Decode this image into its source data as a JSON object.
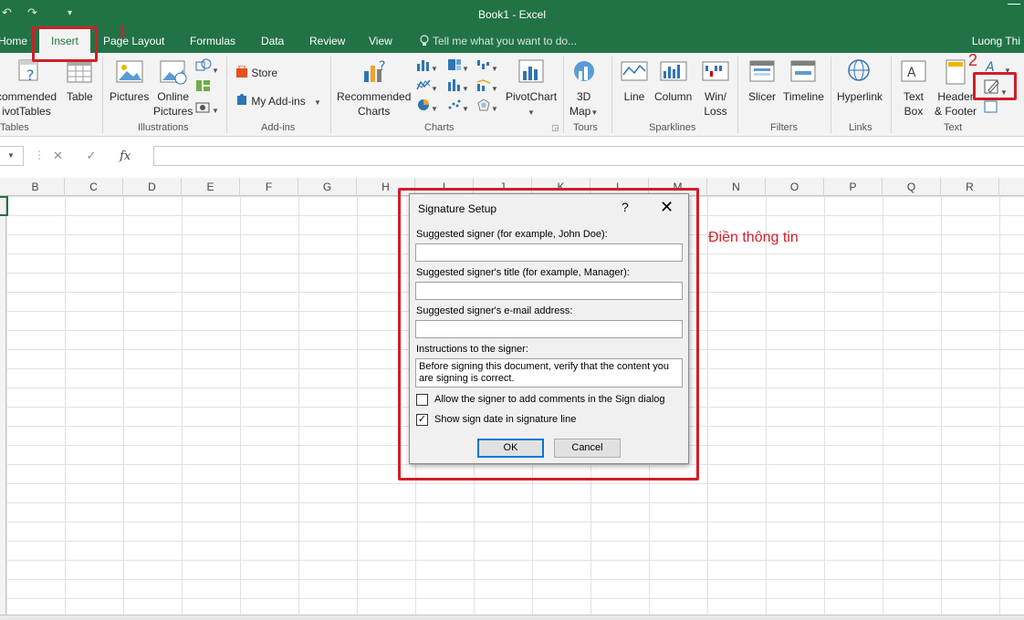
{
  "window": {
    "title": "Book1 - Excel",
    "user": "Luong Thi",
    "qat": {
      "save_icon": "save-icon",
      "redo": "↷",
      "customize": "▾"
    }
  },
  "tabs": [
    "Home",
    "Insert",
    "Page Layout",
    "Formulas",
    "Data",
    "Review",
    "View"
  ],
  "active_tab": "Insert",
  "tell_me": "Tell me what you want to do...",
  "ribbon": {
    "tables": {
      "label": "Tables",
      "pivot_1": "commended",
      "pivot_2": "ivotTables",
      "table": "Table"
    },
    "illustrations": {
      "label": "Illustrations",
      "pictures": "Pictures",
      "online_1": "Online",
      "online_2": "Pictures"
    },
    "addins": {
      "label": "Add-ins",
      "store": "Store",
      "my_addins": "My Add-ins"
    },
    "charts": {
      "label": "Charts",
      "rec_1": "Recommended",
      "rec_2": "Charts",
      "pivotchart": "PivotChart"
    },
    "tours": {
      "label": "Tours",
      "map_1": "3D",
      "map_2": "Map"
    },
    "sparklines": {
      "label": "Sparklines",
      "line": "Line",
      "column": "Column",
      "winloss_1": "Win/",
      "winloss_2": "Loss"
    },
    "filters": {
      "label": "Filters",
      "slicer": "Slicer",
      "timeline": "Timeline"
    },
    "links": {
      "label": "Links",
      "hyperlink": "Hyperlink"
    },
    "text": {
      "label": "Text",
      "textbox_1": "Text",
      "textbox_2": "Box",
      "hf_1": "Header",
      "hf_2": "& Footer"
    }
  },
  "formula_bar": {
    "fx": "fx",
    "cancel": "✕",
    "enter": "✓",
    "value": ""
  },
  "columns": [
    "B",
    "C",
    "D",
    "E",
    "F",
    "G",
    "H",
    "I",
    "J",
    "K",
    "L",
    "M",
    "N",
    "O",
    "P",
    "Q",
    "R"
  ],
  "dialog": {
    "title": "Signature Setup",
    "help": "?",
    "close": "✕",
    "signer_label": "Suggested signer (for example, John Doe):",
    "signer_value": "",
    "title_label": "Suggested signer's title (for example, Manager):",
    "title_value": "",
    "email_label": "Suggested signer's e-mail address:",
    "email_value": "",
    "instructions_label": "Instructions to the signer:",
    "instructions_value": "Before signing this document, verify that the content you are signing is correct.",
    "allow_comments_label": "Allow the signer to add comments in the Sign dialog",
    "allow_comments_checked": false,
    "show_date_label": "Show sign date in signature line",
    "show_date_checked": true,
    "ok": "OK",
    "cancel": "Cancel"
  },
  "annotations": {
    "step1": "1",
    "step2": "2",
    "note": "Điền thông tin",
    "color": "#d01f27"
  },
  "colors": {
    "excel_green": "#217346",
    "ribbon_bg": "#f3f3f3",
    "accent_blue": "#0078d7"
  }
}
